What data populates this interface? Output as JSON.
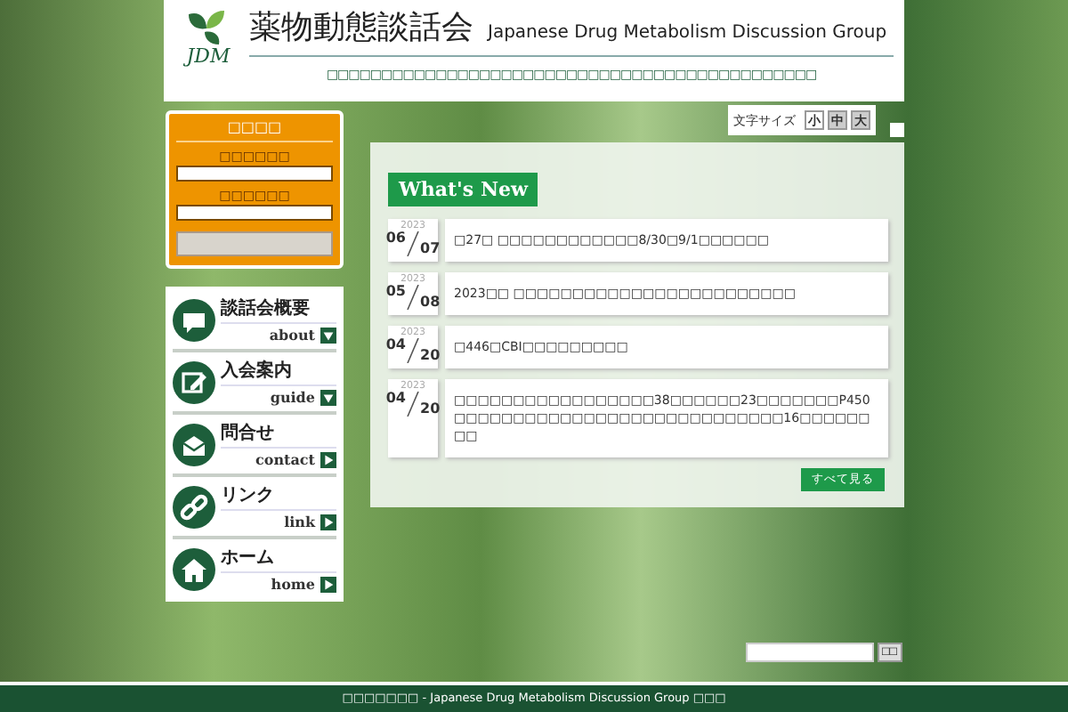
{
  "header": {
    "logo_text": "JDM",
    "title": "薬物動態談話会",
    "subtitle": "Japanese Drug Metabolism Discussion Group",
    "tagline": "□□□□□□□□□□□□□□□□□□□□□□□□□□□□□□□□□□□□□□□□□□□□□"
  },
  "login": {
    "title": "□□□□",
    "fields": [
      {
        "label": "□□□□□□"
      },
      {
        "label": "□□□□□□"
      }
    ]
  },
  "nav": [
    {
      "label": "談話会概要",
      "sub": "about",
      "submenu": true,
      "kind": "chat"
    },
    {
      "label": "入会案内",
      "sub": "guide",
      "submenu": true,
      "kind": "pencil"
    },
    {
      "label": "問合せ",
      "sub": "contact",
      "submenu": false,
      "kind": "mail"
    },
    {
      "label": "リンク",
      "sub": "link",
      "submenu": false,
      "kind": "link"
    },
    {
      "label": "ホーム",
      "sub": "home",
      "submenu": false,
      "kind": "home"
    }
  ],
  "font_size": {
    "label": "文字サイズ",
    "options": [
      {
        "label": "小",
        "selected": true
      },
      {
        "label": "中",
        "selected": false
      },
      {
        "label": "大",
        "selected": false
      }
    ]
  },
  "news": {
    "title": "What's New",
    "items": [
      {
        "year": "2023",
        "month": "06",
        "day": "07",
        "text": "□27□ □□□□□□□□□□□□8/30□9/1□□□□□□"
      },
      {
        "year": "2023",
        "month": "05",
        "day": "08",
        "text": "2023□□ □□□□□□□□□□□□□□□□□□□□□□□□"
      },
      {
        "year": "2023",
        "month": "04",
        "day": "20",
        "text": "□446□CBI□□□□□□□□□"
      },
      {
        "year": "2023",
        "month": "04",
        "day": "20",
        "text": "□□□□□□□□□□□□□□□□□38□□□□□□23□□□□□□□P450□□□□□□□□□□□□□□□□□□□□□□□□□□□□16□□□□□□□□"
      }
    ],
    "more": "すべて見る"
  },
  "search": {
    "button": "□□"
  },
  "footer": "□□□□□□□ - Japanese Drug Metabolism Discussion Group □□□"
}
